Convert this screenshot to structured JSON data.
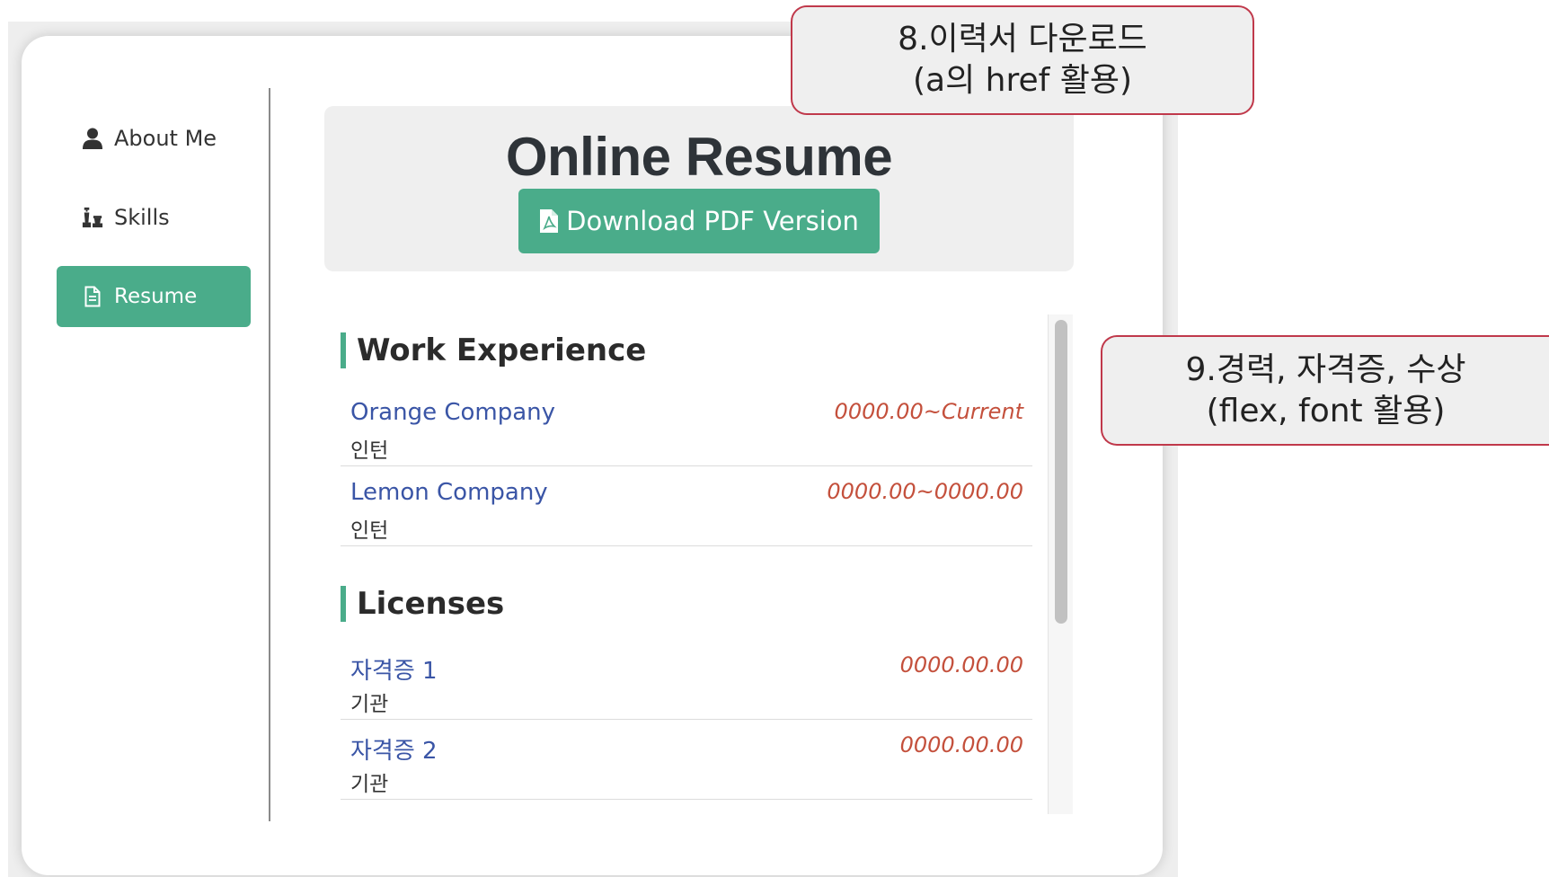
{
  "sidebar": {
    "items": [
      {
        "label": "About Me",
        "icon": "user-icon",
        "active": false
      },
      {
        "label": "Skills",
        "icon": "chess-icon",
        "active": false
      },
      {
        "label": "Resume",
        "icon": "document-icon",
        "active": true
      }
    ]
  },
  "header": {
    "title": "Online Resume",
    "download_label": "Download PDF Version",
    "download_icon": "pdf-file-icon"
  },
  "sections": {
    "work": {
      "title": "Work Experience",
      "entries": [
        {
          "name": "Orange Company",
          "role": "인턴",
          "date": "0000.00~Current"
        },
        {
          "name": "Lemon Company",
          "role": "인턴",
          "date": "0000.00~0000.00"
        }
      ]
    },
    "licenses": {
      "title": "Licenses",
      "entries": [
        {
          "name": "자격증 1",
          "issuer": "기관",
          "date": "0000.00.00"
        },
        {
          "name": "자격증 2",
          "issuer": "기관",
          "date": "0000.00.00"
        }
      ]
    }
  },
  "annotations": {
    "download": {
      "line1": "8.이력서 다운로드",
      "line2": "(a의 href 활용)"
    },
    "experience": {
      "line1": "9.경력, 자격증, 수상",
      "line2": "(flex, font 활용)"
    }
  },
  "colors": {
    "accent": "#4aac8a",
    "link": "#3a55a6",
    "date": "#c4503c",
    "callout_border": "#c0394b"
  }
}
